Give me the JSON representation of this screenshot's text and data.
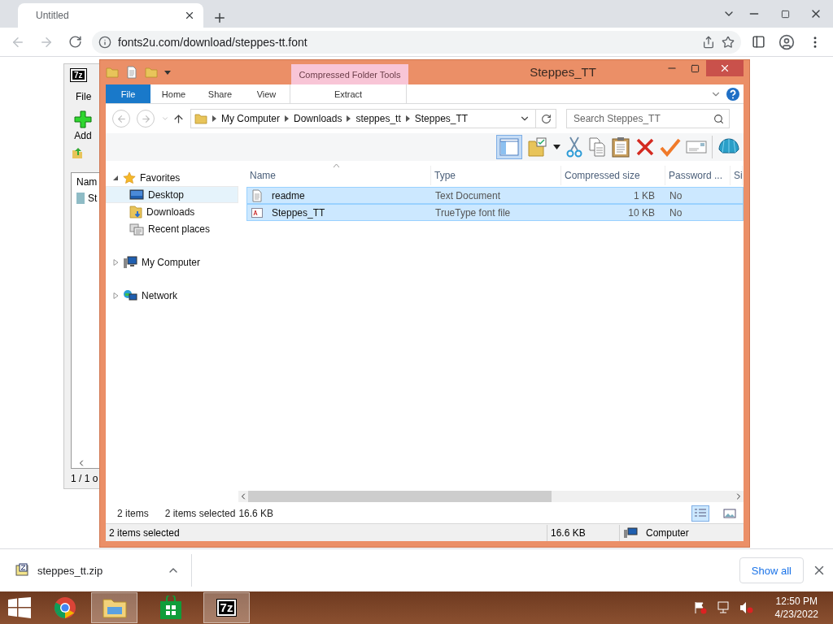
{
  "browser": {
    "tab": {
      "title": "Untitled"
    },
    "url": "fonts2u.com/download/steppes-tt.font",
    "download": {
      "file": "steppes_tt.zip"
    },
    "show_all": "Show all"
  },
  "background_window": {
    "logo": "7z",
    "menu": "File",
    "add": "Add",
    "column": "Nam",
    "row": "St",
    "status": "1 / 1 o"
  },
  "explorer": {
    "title": "Steppes_TT",
    "contextual_tab": "Compressed Folder Tools",
    "ribbon_tabs": [
      {
        "label": "File",
        "kind": "file",
        "selected": false
      },
      {
        "label": "Home",
        "kind": "tab",
        "selected": false
      },
      {
        "label": "Share",
        "kind": "tab",
        "selected": false
      },
      {
        "label": "View",
        "kind": "tab",
        "selected": false
      },
      {
        "label": "Extract",
        "kind": "contextual",
        "selected": false
      }
    ],
    "breadcrumb": [
      "My Computer",
      "Downloads",
      "steppes_tt",
      "Steppes_TT"
    ],
    "search": {
      "placeholder": "Search Steppes_TT"
    },
    "layout_button": {
      "selected": true
    },
    "nav": [
      {
        "label": "Favorites",
        "kind": "favorites",
        "expanded": true,
        "selected": false,
        "children": [
          {
            "label": "Desktop",
            "kind": "desktop",
            "selected": true
          },
          {
            "label": "Downloads",
            "kind": "downloads",
            "selected": false
          },
          {
            "label": "Recent places",
            "kind": "recent",
            "selected": false
          }
        ]
      },
      {
        "label": "My Computer",
        "kind": "computer",
        "expanded": false,
        "selected": false
      },
      {
        "label": "Network",
        "kind": "network",
        "expanded": false,
        "selected": false
      }
    ],
    "columns": [
      "Name",
      "Type",
      "Compressed size",
      "Password ...",
      "Si"
    ],
    "rows": [
      {
        "name": "readme",
        "kind": "text",
        "type": "Text Document",
        "size": "1 KB",
        "password": "No",
        "selected": true
      },
      {
        "name": "Steppes_TT",
        "kind": "font",
        "type": "TrueType font file",
        "size": "10 KB",
        "password": "No",
        "selected": true
      }
    ],
    "details": {
      "count": "2 items",
      "selected": "2 items selected",
      "size": "16.6 KB"
    },
    "status": {
      "selected": "2 items selected",
      "size": "16.6 KB",
      "location": "Computer"
    }
  },
  "taskbar": {
    "time": "12:50 PM",
    "date": "4/23/2022",
    "apps": [
      {
        "kind": "chrome",
        "selected": false
      },
      {
        "kind": "explorer",
        "selected": true
      },
      {
        "kind": "store",
        "selected": false
      },
      {
        "kind": "sevenzip",
        "label": "7z",
        "selected": true
      }
    ]
  }
}
